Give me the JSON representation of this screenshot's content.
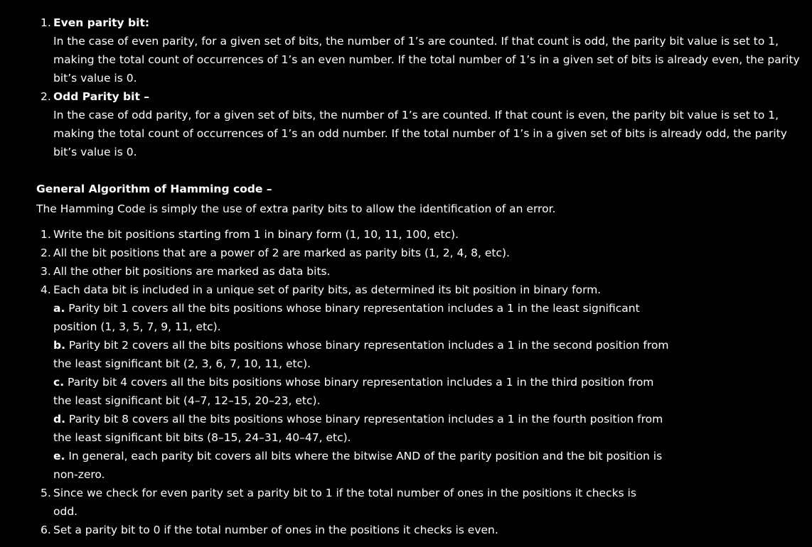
{
  "parity_types": [
    {
      "num": "1.",
      "title": "Even parity bit:",
      "lines": [
        "In the case of even parity, for a given set of bits, the number of 1’s are counted. If that count is odd, the parity bit value is set to 1,",
        "making the total count of occurrences of 1’s an even number. If the total number of 1’s in a given set of bits is already even, the parity",
        "bit’s value is 0."
      ]
    },
    {
      "num": "2.",
      "title": "Odd Parity bit –",
      "lines": [
        "In the case of odd parity, for a given set of bits, the number of 1’s are counted. If that count is even, the parity bit value is set to 1,",
        "making the total count of occurrences of 1’s an odd number. If the total number of 1’s in a given set of bits is already odd, the parity",
        "bit’s value is 0."
      ]
    }
  ],
  "algorithm": {
    "heading": "General Algorithm of Hamming code –",
    "intro": "The Hamming Code is simply the use of extra parity bits to allow the identification of an error.",
    "steps": [
      {
        "num": "1.",
        "text": "Write the bit positions starting from 1 in binary form (1, 10, 11, 100, etc)."
      },
      {
        "num": "2.",
        "text": "All the bit positions that are a power of 2 are marked as parity bits (1, 2, 4, 8, etc)."
      },
      {
        "num": "3.",
        "text": "All the other bit positions are marked as data bits."
      },
      {
        "num": "4.",
        "text": "Each data bit is included in a unique set of parity bits, as determined its bit position in binary form."
      }
    ],
    "sub_steps": [
      {
        "letter": "a.",
        "line1": "Parity bit 1 covers all the bits positions whose binary representation includes a 1 in the least significant",
        "line2": "position (1, 3, 5, 7, 9, 11, etc)."
      },
      {
        "letter": "b.",
        "line1": "Parity bit 2 covers all the bits positions whose binary representation includes a 1 in the second position from",
        "line2": "the least significant bit (2, 3, 6, 7, 10, 11, etc)."
      },
      {
        "letter": "c.",
        "line1": "Parity bit 4 covers all the bits positions whose binary representation includes a 1 in the third position from",
        "line2": "the least significant bit (4–7, 12–15, 20–23, etc)."
      },
      {
        "letter": "d.",
        "line1": "Parity bit 8 covers all the bits positions whose binary representation includes a 1 in the fourth position from",
        "line2": "the least significant bit bits (8–15, 24–31, 40–47, etc)."
      },
      {
        "letter": "e.",
        "line1": "In general, each parity bit covers all bits where the bitwise AND of the parity position and the bit position is",
        "line2": "non-zero."
      }
    ],
    "later_steps": [
      {
        "num": "5.",
        "line1": "Since we check for even parity set a parity bit to 1 if the total number of ones in the positions it checks is",
        "line2": "odd."
      },
      {
        "num": "6.",
        "line1": "Set a parity bit to 0 if the total number of ones in the positions it checks is even.",
        "line2": ""
      }
    ]
  }
}
